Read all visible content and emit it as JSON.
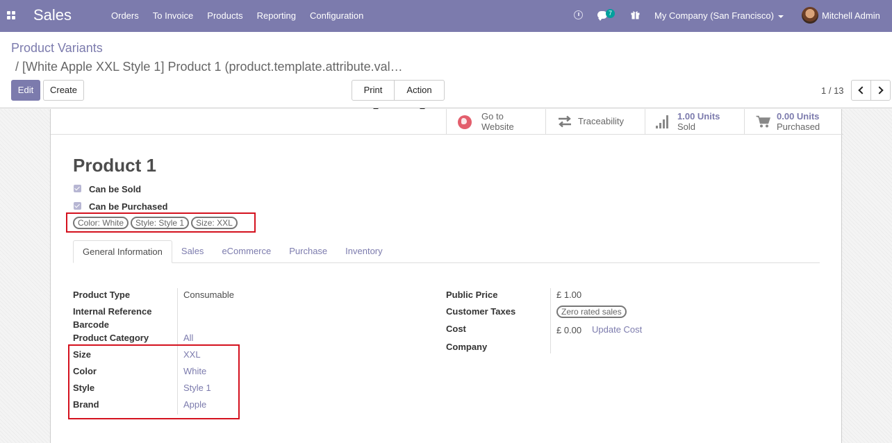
{
  "navbar": {
    "app_title": "Sales",
    "menu": [
      "Orders",
      "To Invoice",
      "Products",
      "Reporting",
      "Configuration"
    ],
    "chat_count": "7",
    "company": "My Company (San Francisco)",
    "user": "Mitchell Admin",
    "bg_color": "#7c7bad"
  },
  "breadcrumb": {
    "root": "Product Variants",
    "current": "/ [White Apple XXL Style 1] Product 1 (product.template.attribute.val…"
  },
  "toolbar": {
    "edit_label": "Edit",
    "create_label": "Create",
    "print_label": "Print",
    "action_label": "Action"
  },
  "pager": {
    "value": "1 / 13"
  },
  "smart_buttons": {
    "website": {
      "line1": "Go to",
      "line2": "Website"
    },
    "traceability": {
      "label": "Traceability"
    },
    "sold": {
      "value": "1.00 Units",
      "label": "Sold"
    },
    "purchased": {
      "value": "0.00 Units",
      "label": "Purchased"
    }
  },
  "product": {
    "name": "Product 1",
    "can_be_sold_label": "Can be Sold",
    "can_be_purchased_label": "Can be Purchased",
    "attribute_tags": [
      "Color: White",
      "Style: Style 1",
      "Size: XXL"
    ]
  },
  "tabs": [
    "General Information",
    "Sales",
    "eCommerce",
    "Purchase",
    "Inventory"
  ],
  "left_fields": [
    {
      "label": "Product Type",
      "value": "Consumable"
    },
    {
      "label": "Internal Reference",
      "value": ""
    },
    {
      "label": "Barcode",
      "value": ""
    },
    {
      "label": "Product Category",
      "value": "All"
    },
    {
      "label": "Size",
      "value": "XXL"
    },
    {
      "label": "Color",
      "value": "White"
    },
    {
      "label": "Style",
      "value": "Style 1"
    },
    {
      "label": "Brand",
      "value": "Apple"
    }
  ],
  "right_fields": {
    "public_price": {
      "label": "Public Price",
      "value": "£ 1.00"
    },
    "customer_taxes": {
      "label": "Customer Taxes",
      "tag": "Zero rated sales"
    },
    "cost": {
      "label": "Cost",
      "value": "£ 0.00",
      "action": "Update Cost"
    },
    "company": {
      "label": "Company",
      "value": ""
    }
  }
}
